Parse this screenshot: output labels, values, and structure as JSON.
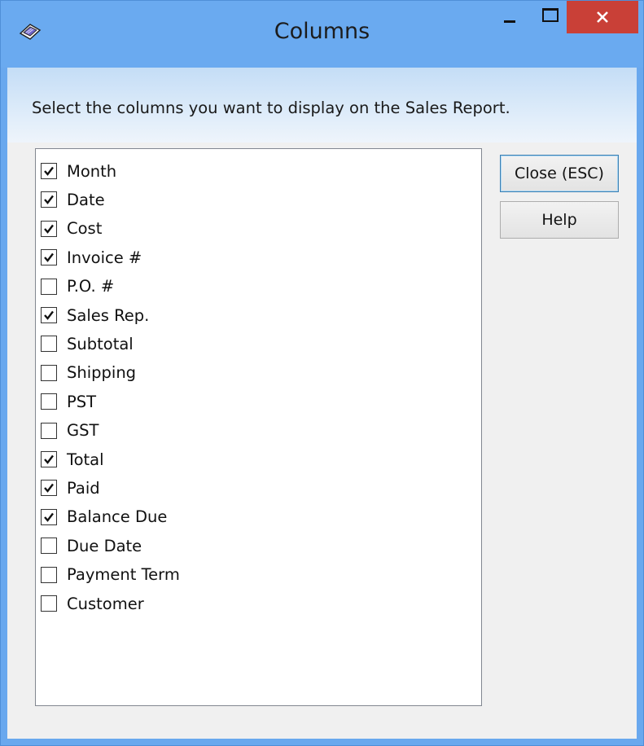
{
  "window": {
    "title": "Columns",
    "icon": "book-icon",
    "controls": {
      "minimize": "minimize-icon",
      "maximize": "maximize-icon",
      "close": "close-icon",
      "close_color": "#c94037"
    }
  },
  "instructions": "Select the columns you want to display on the Sales Report.",
  "columns": [
    {
      "label": "Month",
      "checked": true
    },
    {
      "label": "Date",
      "checked": true
    },
    {
      "label": "Cost",
      "checked": true
    },
    {
      "label": "Invoice #",
      "checked": true
    },
    {
      "label": "P.O. #",
      "checked": false
    },
    {
      "label": "Sales Rep.",
      "checked": true
    },
    {
      "label": "Subtotal",
      "checked": false
    },
    {
      "label": "Shipping",
      "checked": false
    },
    {
      "label": "PST",
      "checked": false
    },
    {
      "label": "GST",
      "checked": false
    },
    {
      "label": "Total",
      "checked": true
    },
    {
      "label": "Paid",
      "checked": true
    },
    {
      "label": "Balance Due",
      "checked": true
    },
    {
      "label": "Due Date",
      "checked": false
    },
    {
      "label": "Payment Term",
      "checked": false
    },
    {
      "label": "Customer",
      "checked": false
    }
  ],
  "buttons": {
    "close_label": "Close (ESC)",
    "help_label": "Help"
  },
  "colors": {
    "titlebar": "#6aaaf0",
    "client_bg": "#f0f0f0"
  }
}
